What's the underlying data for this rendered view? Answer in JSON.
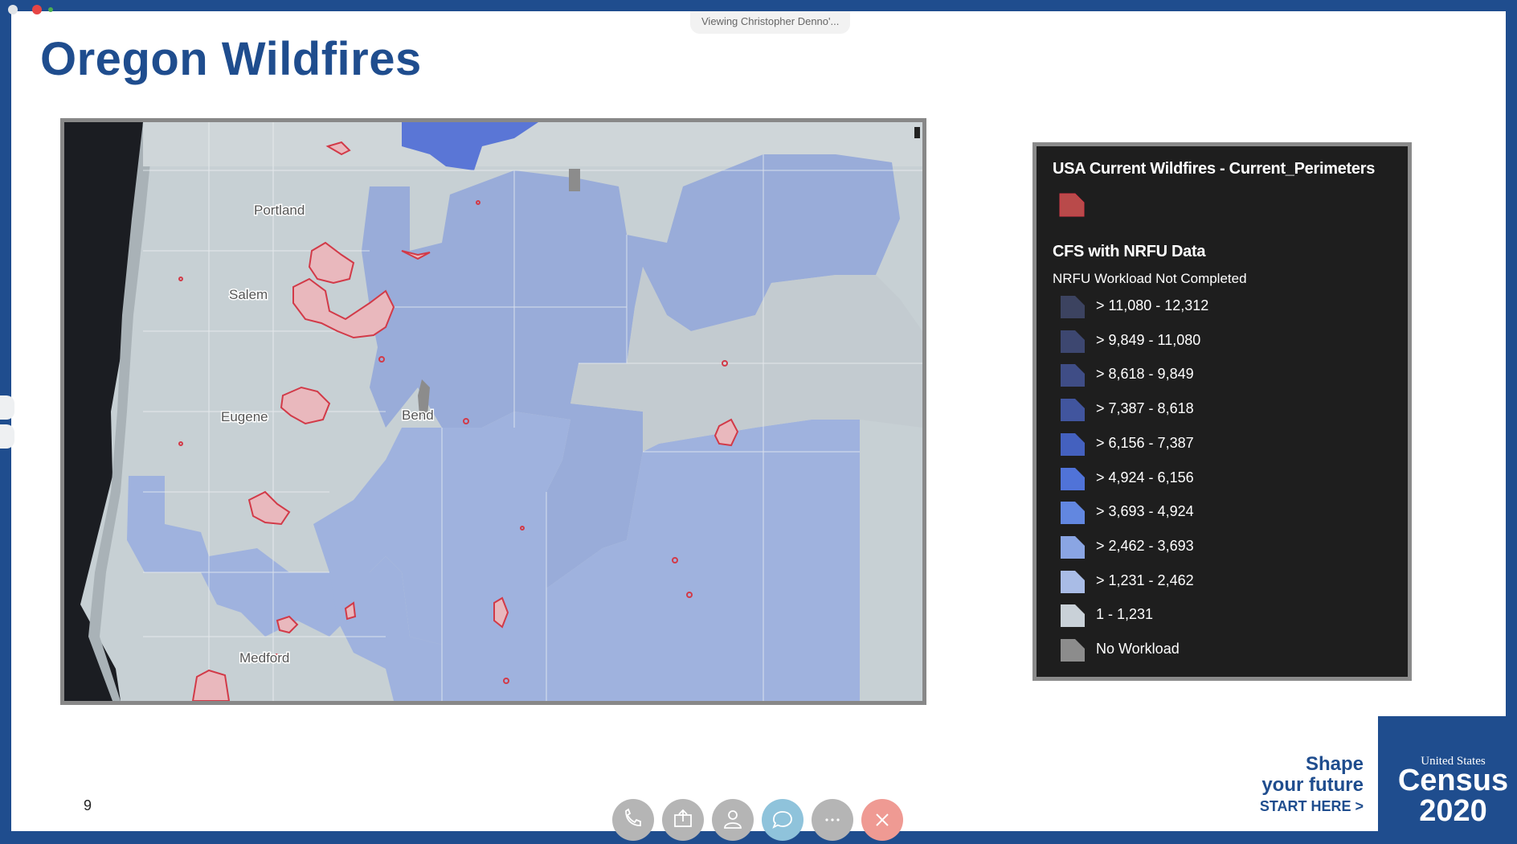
{
  "viewer": {
    "banner": "Viewing Christopher Denno'..."
  },
  "slide": {
    "title": "Oregon Wildfires",
    "page_number": "9"
  },
  "map": {
    "city_labels": [
      "Portland",
      "Salem",
      "Eugene",
      "Bend",
      "Medford"
    ]
  },
  "legend": {
    "layer1_title": "USA Current Wildfires - Current_Perimeters",
    "layer2_title": "CFS with NRFU Data",
    "layer2_subtitle": "NRFU Workload Not Completed",
    "perimeter_color": "#b94a4a",
    "classes": [
      {
        "label": "> 11,080 - 12,312",
        "color": "#3c4360"
      },
      {
        "label": "> 9,849 - 11,080",
        "color": "#3d4770"
      },
      {
        "label": "> 8,618 - 9,849",
        "color": "#3f4d86"
      },
      {
        "label": "> 7,387 - 8,618",
        "color": "#41559e"
      },
      {
        "label": "> 6,156 - 7,387",
        "color": "#4461bf"
      },
      {
        "label": "> 4,924 - 6,156",
        "color": "#5073d8"
      },
      {
        "label": "> 3,693 - 4,924",
        "color": "#6287e0"
      },
      {
        "label": "> 2,462 - 3,693",
        "color": "#8aa5e3"
      },
      {
        "label": "> 1,231 - 2,462",
        "color": "#a9bce6"
      },
      {
        "label": "1 - 1,231",
        "color": "#c9d1d8"
      },
      {
        "label": "No Workload",
        "color": "#8c8c8c"
      }
    ]
  },
  "branding": {
    "shape": "Shape",
    "your_future": "your future",
    "start_here": "START HERE >",
    "census_small": "United States",
    "census_word": "Census",
    "census_year": "2020"
  },
  "toolbar": {
    "buttons": [
      {
        "icon": "phone-icon",
        "color": "#b5b5b5"
      },
      {
        "icon": "share-screen-icon",
        "color": "#b5b5b5"
      },
      {
        "icon": "participants-icon",
        "color": "#b5b5b5"
      },
      {
        "icon": "chat-icon",
        "color": "#8fc3db"
      },
      {
        "icon": "more-icon",
        "color": "#b5b5b5"
      },
      {
        "icon": "hang-up-icon",
        "color": "#ef9a93"
      }
    ]
  }
}
